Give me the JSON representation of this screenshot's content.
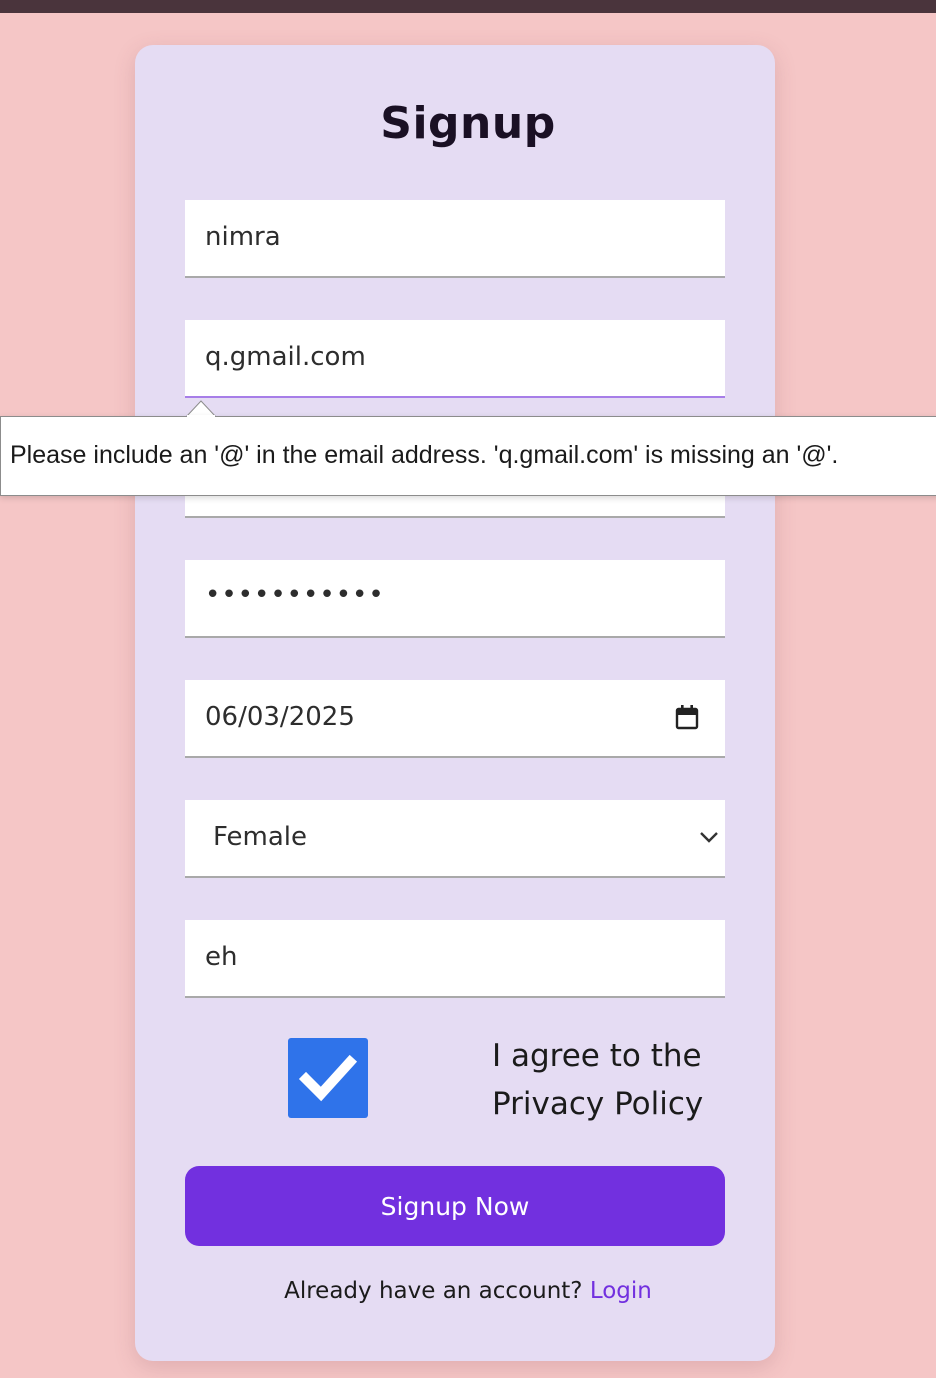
{
  "window": {
    "title": "Signup"
  },
  "form": {
    "title": "Signup",
    "fields": {
      "username": "nimra",
      "email": "q.gmail.com",
      "password_mask": "•••••••••••",
      "date": "06/03/2025",
      "gender": "Female",
      "extra": "eh"
    },
    "validation_message": "Please include an '@' in the email address. 'q.gmail.com' is missing an '@'.",
    "agree_line1": "I agree to the",
    "agree_line2": "Privacy Policy",
    "agree_checked": true,
    "submit_label": "Signup Now",
    "footer_text": "Already have an account?",
    "login_link": "Login"
  },
  "colors": {
    "page_bg": "#f5c6c6",
    "card_bg": "#e5dcf3",
    "accent": "#7230df",
    "checkbox": "#2f73ea",
    "focus_border": "#a77ee8"
  },
  "icons": [
    "calendar-icon",
    "chevron-down-icon",
    "checkmark-icon"
  ]
}
